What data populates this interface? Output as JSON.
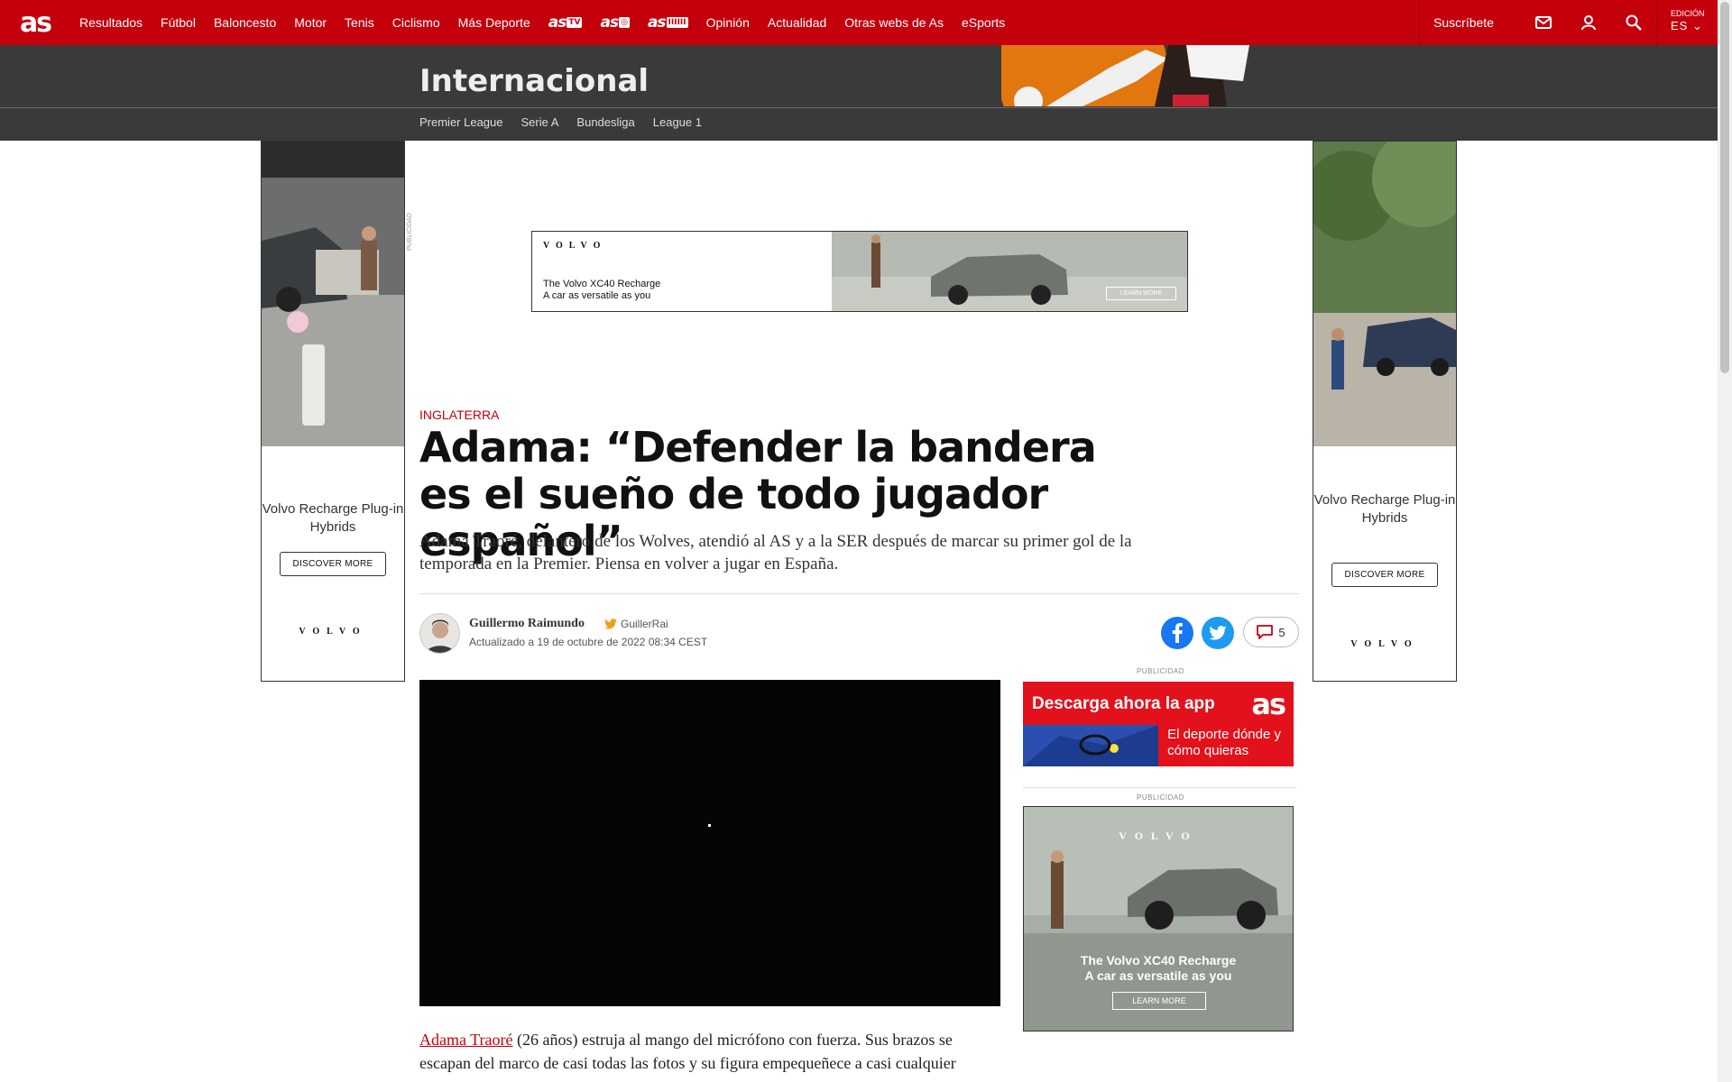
{
  "nav": {
    "logo": "as",
    "links": [
      "Resultados",
      "Fútbol",
      "Baloncesto",
      "Motor",
      "Tenis",
      "Ciclismo",
      "Más Deporte"
    ],
    "brands": [
      {
        "text": "as",
        "badge": "TV"
      },
      {
        "text": "as",
        "badge": "◎"
      },
      {
        "text": "as",
        "badge": "IIIIII"
      }
    ],
    "links2": [
      "Opinión",
      "Actualidad",
      "Otras webs de As",
      "eSports"
    ],
    "subscribe": "Suscríbete",
    "edition_label": "EDICIÓN",
    "edition_value": "ES"
  },
  "section": {
    "title": "Internacional",
    "subnav": [
      "Premier League",
      "Serie A",
      "Bundesliga",
      "League 1"
    ]
  },
  "ads": {
    "publicidad": "PUBLICIDAD",
    "side_text": "Volvo Recharge Plug-in Hybrids",
    "side_button": "DISCOVER MORE",
    "side_brand": "VOLVO",
    "banner_brand": "VOLVO",
    "banner_line1": "The Volvo XC40 Recharge",
    "banner_line2": "A car as versatile as you",
    "banner_button": "LEARN MORE",
    "app_title": "Descarga ahora la app",
    "app_logo": "as",
    "app_sub1": "El deporte dónde y",
    "app_sub2": "cómo quieras",
    "rect_brand": "VOLVO",
    "rect_line1": "The Volvo XC40 Recharge",
    "rect_line2": "A car as versatile as you",
    "rect_button": "LEARN MORE"
  },
  "article": {
    "kicker": "INGLATERRA",
    "headline": "Adama: “Defender la bandera es el sueño de todo jugador español”",
    "standfirst": "Adama Traoré, delantero de los Wolves, atendió al AS y a la SER después de marcar su primer gol de la temporada en la Premier. Piensa en volver a jugar en España.",
    "author": "Guillermo Raimundo",
    "twitter": "GuillerRai",
    "updated": "Actualizado a 19 de octubre de 2022 08:34 CEST",
    "comments": "5",
    "body_link": "Adama Traoré",
    "body_text": " (26 años) estruja al mango del micrófono con fuerza. Sus brazos se escapan del marco de casi todas las fotos y su figura empequeñece a casi cualquier"
  },
  "colors": {
    "brand_red": "#c4000d",
    "section_bg": "#3a3a3a",
    "facebook": "#1877f2",
    "twitter": "#1d9bf0"
  }
}
